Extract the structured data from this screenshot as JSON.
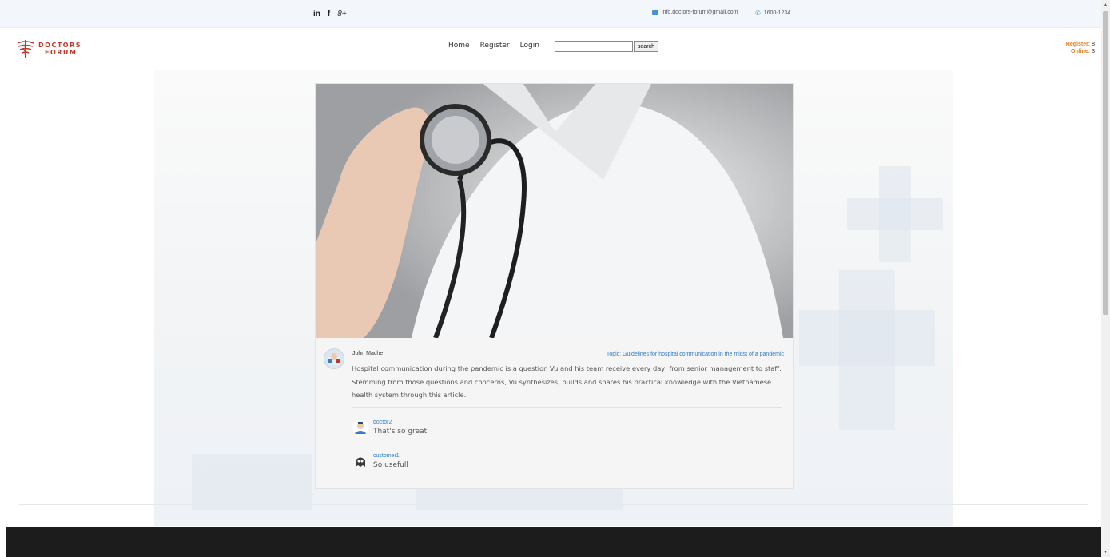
{
  "topbar": {
    "social": [
      {
        "label": "in",
        "icon": "linkedin-icon"
      },
      {
        "label": "f",
        "icon": "facebook-icon"
      },
      {
        "label": "8+",
        "icon": "google-plus-icon"
      }
    ],
    "email": "info.doctors-forum@gmail.com",
    "phone": "1600-1234"
  },
  "header": {
    "logo_line1": "DOCTORS",
    "logo_line2": "FORUM",
    "nav": [
      "Home",
      "Register",
      "Login"
    ],
    "search_placeholder": "",
    "search_button": "search",
    "stats": {
      "register_label": "Register:",
      "register_value": "8",
      "online_label": "Online:",
      "online_value": "3"
    }
  },
  "post": {
    "author": "John Mache",
    "topic": "Topic: Guidelines for hospital communication in the midst of a pandemic",
    "body": "Hospital communication during the pandemic is a question Vu and his team receive every day, from senior management to staff. Stemming from those questions and concerns, Vu synthesizes, builds and shares his practical knowledge with the Vietnamese health system through this article.",
    "comments": [
      {
        "user": "doctor2",
        "text": "That's so great"
      },
      {
        "user": "customer1",
        "text": "So usefull"
      }
    ]
  },
  "colors": {
    "brand": "#c0392b",
    "link": "#2e7bc4",
    "stats": "#e67e22",
    "footer": "#1c1c1c"
  }
}
